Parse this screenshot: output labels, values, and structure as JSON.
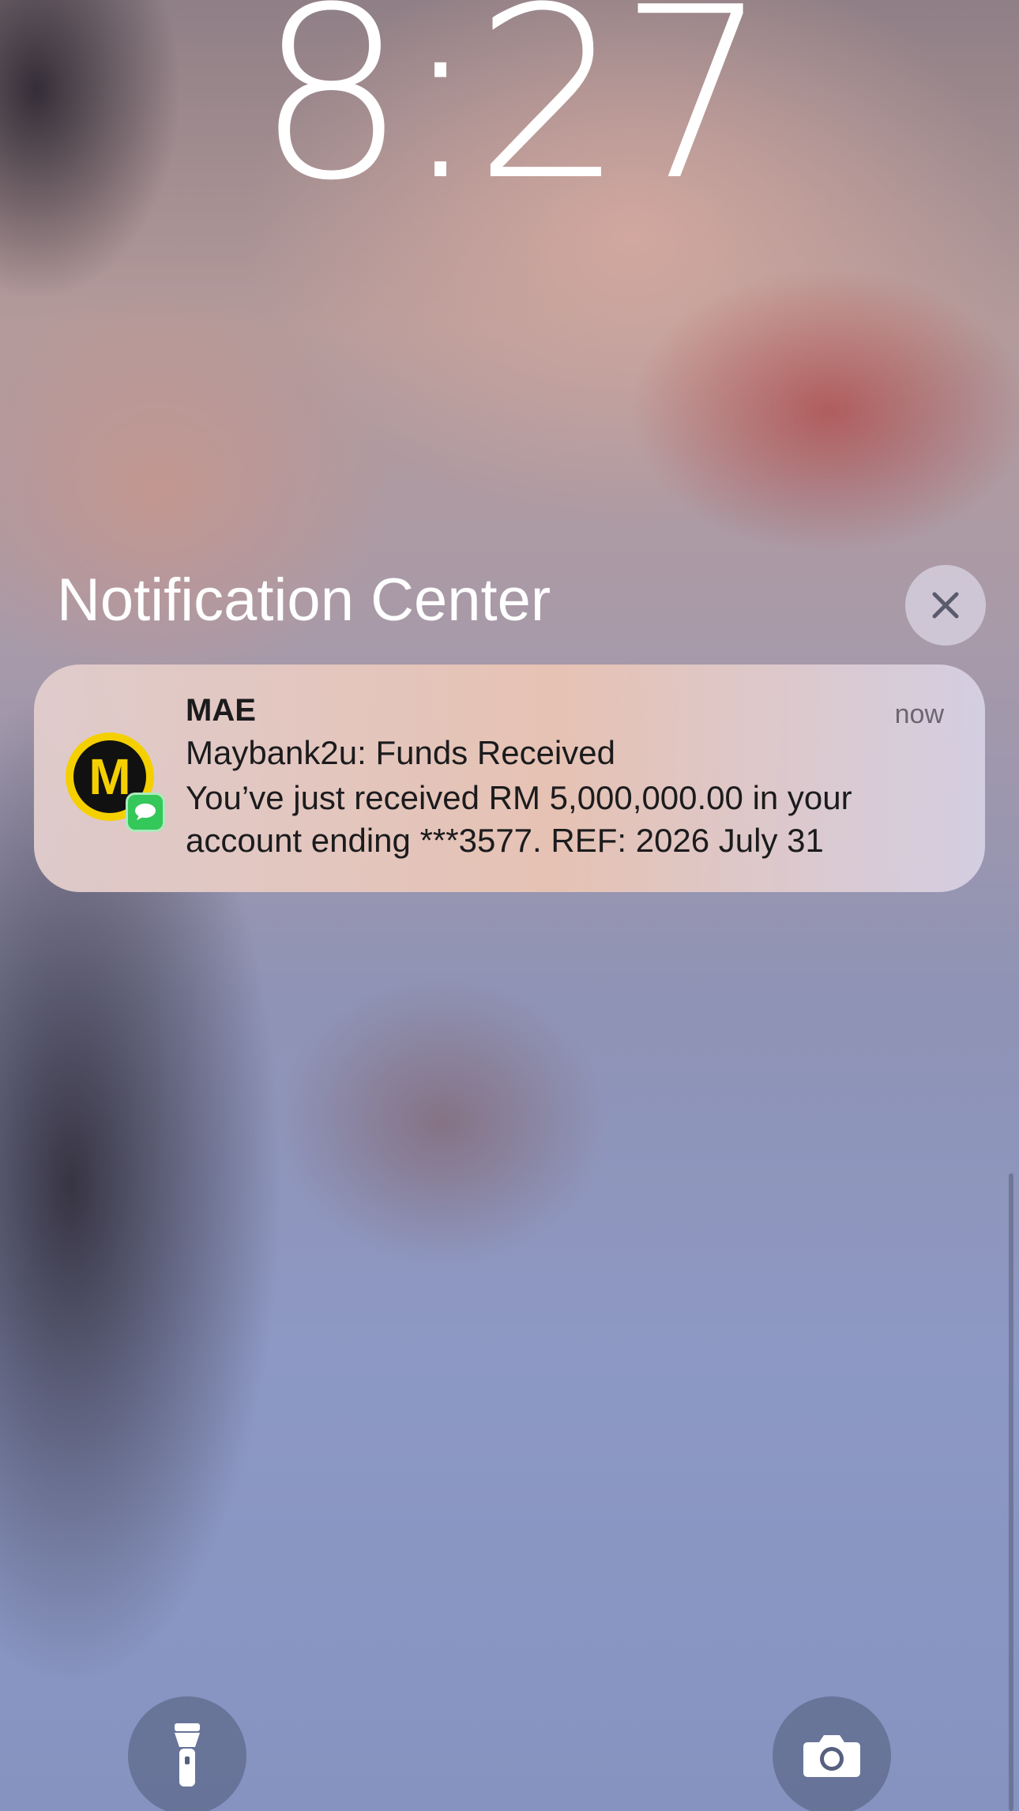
{
  "lock_screen": {
    "time": "8:27"
  },
  "notification_center": {
    "title": "Notification Center",
    "close_icon": "close-icon"
  },
  "notification": {
    "app_name": "MAE",
    "app_icon_letter": "M",
    "app_icon": "maybank-mae-icon",
    "badge_icon": "messages-icon",
    "time": "now",
    "title": "Maybank2u: Funds Received",
    "body": "You’ve just received RM 5,000,000.00 in your account ending ***3577. REF: 2026 July 31"
  },
  "quick_actions": {
    "flashlight_icon": "flashlight-icon",
    "camera_icon": "camera-icon"
  },
  "colors": {
    "mae_yellow": "#f5d000",
    "messages_green": "#34c759"
  }
}
